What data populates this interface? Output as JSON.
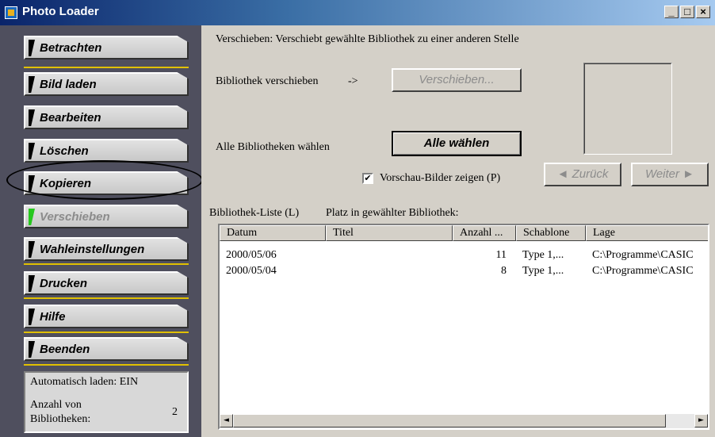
{
  "window": {
    "title": "Photo Loader",
    "min": "_",
    "max": "□",
    "close": "×"
  },
  "sidebar": {
    "items": [
      {
        "label": "Betrachten"
      },
      {
        "label": "Bild laden"
      },
      {
        "label": "Bearbeiten"
      },
      {
        "label": "Löschen"
      },
      {
        "label": "Kopieren"
      },
      {
        "label": "Verschieben"
      },
      {
        "label": "Wahleinstellungen"
      },
      {
        "label": "Drucken"
      },
      {
        "label": "Hilfe"
      },
      {
        "label": "Beenden"
      }
    ],
    "status": {
      "autoload": "Automatisch laden: EIN",
      "count_label": "Anzahl von Bibliotheken:",
      "count_value": "2"
    }
  },
  "main": {
    "description": "Verschieben: Verschiebt gewählte Bibliothek zu einer anderen Stelle",
    "move_label": "Bibliothek verschieben",
    "arrow": "->",
    "move_button": "Verschieben...",
    "select_all_label": "Alle Bibliotheken wählen",
    "select_all_button": "Alle wählen",
    "preview_check_label": "Vorschau-Bilder zeigen (P)",
    "preview_checked": "✔",
    "back_button": "◄ Zurück",
    "next_button": "Weiter ►",
    "list_label": "Bibliothek-Liste (L)",
    "place_label": "Platz in gewählter Bibliothek:"
  },
  "table": {
    "columns": [
      "Datum",
      "Titel",
      "Anzahl ...",
      "Schablone",
      "Lage"
    ],
    "rows": [
      [
        "2000/05/06",
        "",
        "11",
        "Type 1,...",
        "C:\\Programme\\CASIC"
      ],
      [
        "2000/05/04",
        "",
        "8",
        "Type 1,...",
        "C:\\Programme\\CASIC"
      ]
    ]
  },
  "scrollbar": {
    "left": "◄",
    "right": "►"
  }
}
